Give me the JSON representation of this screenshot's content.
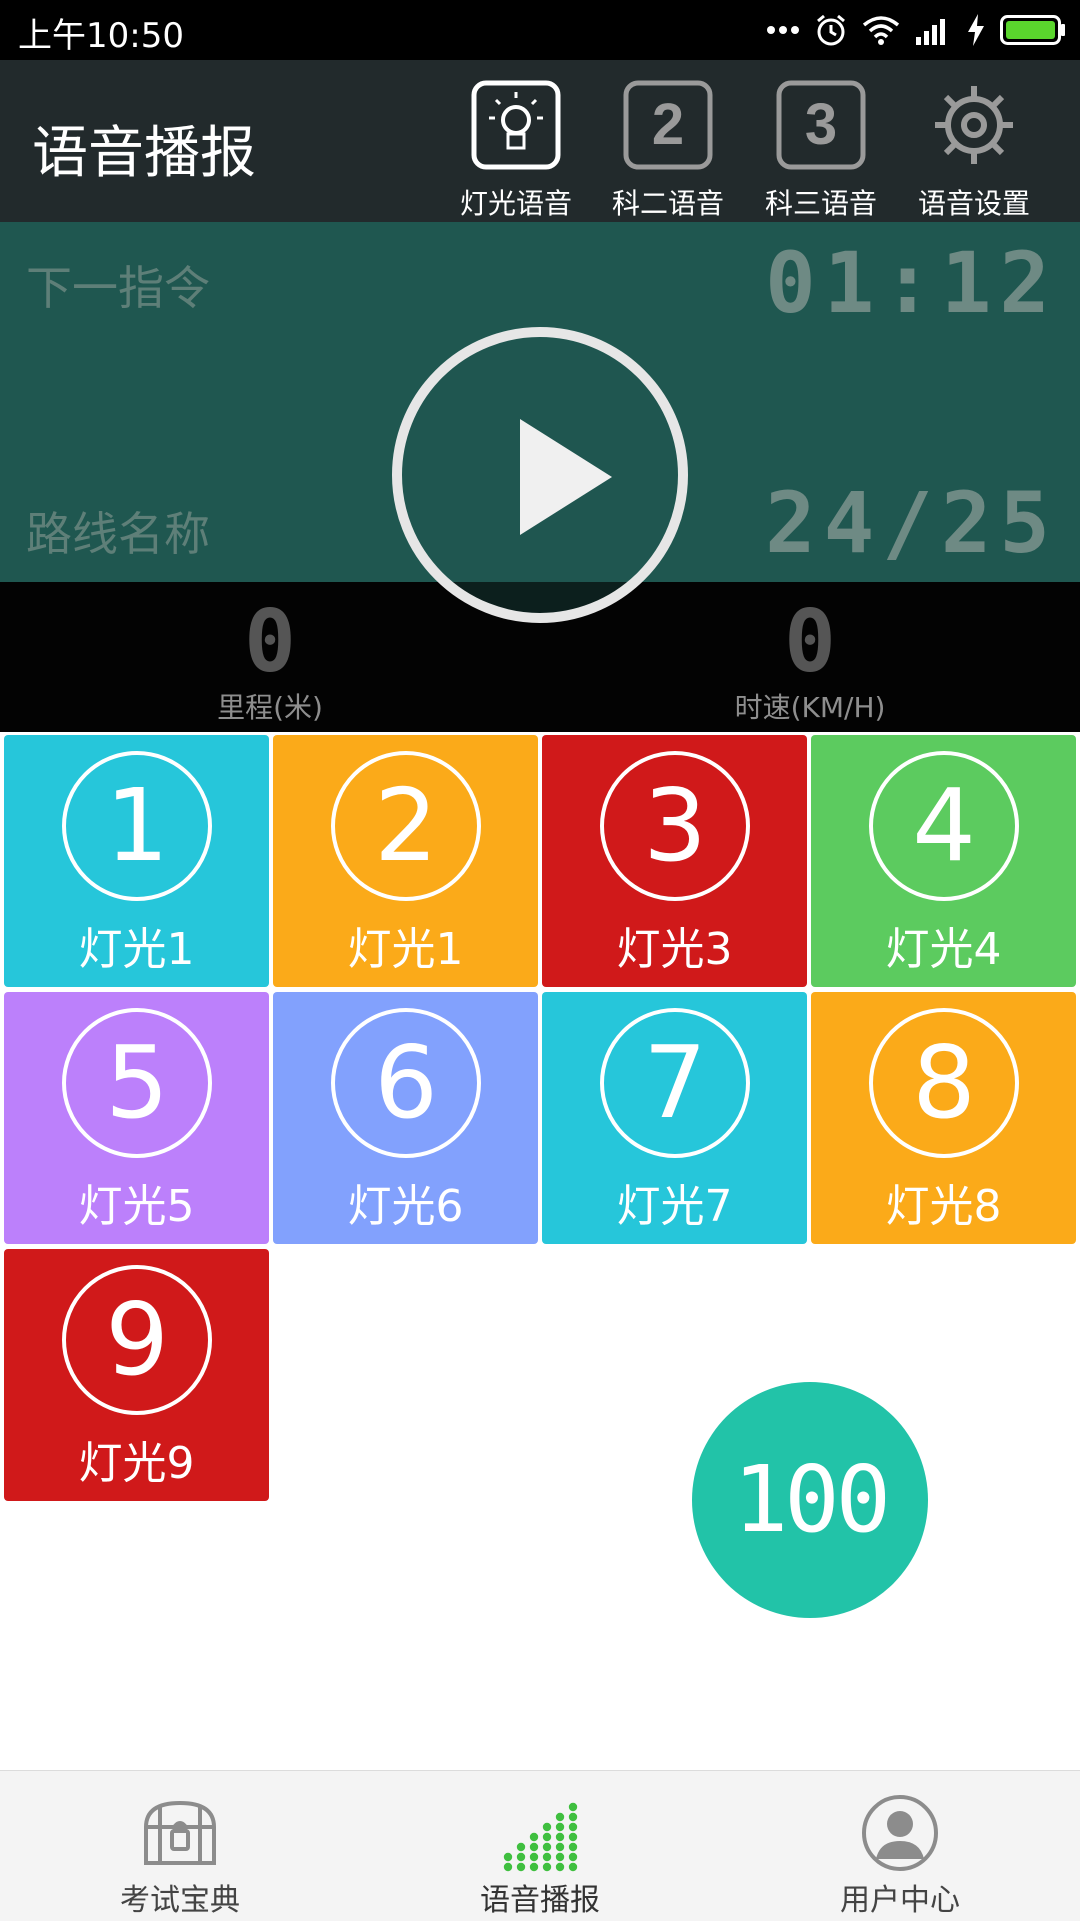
{
  "status_bar": {
    "time": "上午10:50",
    "icons": [
      "more-dots-icon",
      "alarm-icon",
      "wifi-icon",
      "signal-icon",
      "charging-icon",
      "battery-icon"
    ]
  },
  "header": {
    "title": "语音播报",
    "modes": [
      {
        "label": "灯光语音",
        "icon": "bulb-icon",
        "selected": true
      },
      {
        "label": "科二语音",
        "icon": "number-2-icon",
        "selected": false
      },
      {
        "label": "科三语音",
        "icon": "number-3-icon",
        "selected": false
      },
      {
        "label": "语音设置",
        "icon": "gear-icon",
        "selected": false
      }
    ]
  },
  "panel": {
    "next_command_label": "下一指令",
    "timer": "01:12",
    "route_label": "路线名称",
    "progress": "24/25"
  },
  "stats": {
    "distance_value": "0",
    "distance_label": "里程(米)",
    "speed_value": "0",
    "speed_label": "时速(KM/H)"
  },
  "tiles": [
    {
      "number": "1",
      "label": "灯光1",
      "color": "#26c6da"
    },
    {
      "number": "2",
      "label": "灯光1",
      "color": "#fbaa19"
    },
    {
      "number": "3",
      "label": "灯光3",
      "color": "#d0191a"
    },
    {
      "number": "4",
      "label": "灯光4",
      "color": "#5ccb5f"
    },
    {
      "number": "5",
      "label": "灯光5",
      "color": "#bc80fb"
    },
    {
      "number": "6",
      "label": "灯光6",
      "color": "#82a1fd"
    },
    {
      "number": "7",
      "label": "灯光7",
      "color": "#26c6da"
    },
    {
      "number": "8",
      "label": "灯光8",
      "color": "#fbaa19"
    },
    {
      "number": "9",
      "label": "灯光9",
      "color": "#d0191a"
    }
  ],
  "speed_bubble": {
    "value": "100",
    "color": "#22c3a8"
  },
  "bottom_nav": {
    "items": [
      {
        "label": "考试宝典",
        "icon": "treasure-chest-icon",
        "active": false
      },
      {
        "label": "语音播报",
        "icon": "audio-bars-icon",
        "active": true
      },
      {
        "label": "用户中心",
        "icon": "user-avatar-icon",
        "active": false
      }
    ]
  },
  "colors": {
    "header_bg": "#222a2c",
    "panel_bg": "#1f5750",
    "active_nav": "#3fbf3f"
  }
}
